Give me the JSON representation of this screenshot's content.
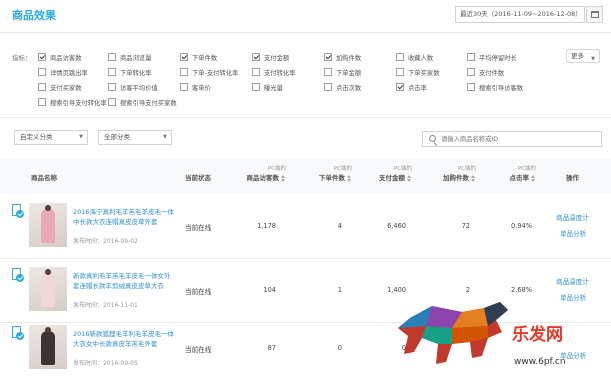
{
  "header": {
    "title": "商品效果",
    "date_range": "最近30天（2016-11-09~2016-12-08）"
  },
  "metrics": {
    "label": "指标：",
    "more_label": "更多",
    "options": [
      {
        "label": "商品访客数",
        "checked": true
      },
      {
        "label": "商品浏览量",
        "checked": false
      },
      {
        "label": "下单件数",
        "checked": true
      },
      {
        "label": "支付金额",
        "checked": true
      },
      {
        "label": "加购件数",
        "checked": true
      },
      {
        "label": "收藏人数",
        "checked": false
      },
      {
        "label": "平均停留时长",
        "checked": false
      },
      {
        "label": "详情页跳出率",
        "checked": false
      },
      {
        "label": "下单转化率",
        "checked": false
      },
      {
        "label": "下单-支付转化率",
        "checked": false
      },
      {
        "label": "支付转化率",
        "checked": false
      },
      {
        "label": "下单金额",
        "checked": false
      },
      {
        "label": "下单买家数",
        "checked": false
      },
      {
        "label": "支付件数",
        "checked": false
      },
      {
        "label": "支付买家数",
        "checked": false
      },
      {
        "label": "访客平均价值",
        "checked": false
      },
      {
        "label": "客单价",
        "checked": false
      },
      {
        "label": "曝光量",
        "checked": false
      },
      {
        "label": "点击次数",
        "checked": false
      },
      {
        "label": "点击率",
        "checked": true
      },
      {
        "label": "搜索引导访客数",
        "checked": false
      },
      {
        "label": "搜索引导支付转化率",
        "checked": false
      },
      {
        "label": "搜索引导支付买家数",
        "checked": false
      }
    ]
  },
  "filters": {
    "custom_category": "自定义分类",
    "all_category": "全部分类",
    "search_placeholder": "请输入商品名称或ID"
  },
  "table": {
    "columns": {
      "product_name": "商品名称",
      "status": "当前状态",
      "visitors_pre": "PC端的",
      "visitors": "商品访客数",
      "order_pre": "PC端的",
      "order": "下单件数",
      "pay_pre": "PC端的",
      "pay": "支付金额",
      "cart_pre": "PC端的",
      "cart": "加购件数",
      "ctr_pre": "PC端的",
      "ctr": "点击率",
      "actions": "操作"
    },
    "rows": [
      {
        "title": "2016海宁真利毛羊羔毛羊皮毛一体中长款大衣连帽真皮皮草外套",
        "publish_time": "发布时间：2016-09-02",
        "status": "当前在线",
        "visitors": "1,178",
        "orders": "4",
        "pay": "6,460",
        "cart": "72",
        "ctr": "0.94%",
        "action1": "商品温度计",
        "action2": "单品分析",
        "thumb_color": "#e9a9b6"
      },
      {
        "title": "新款真利毛羊羔毛羊皮毛一体女外套连帽长款羊剪绒真皮皮草大衣",
        "publish_time": "发布时间：2016-11-01",
        "status": "当前在线",
        "visitors": "104",
        "orders": "1",
        "pay": "1,400",
        "cart": "2",
        "ctr": "2.68%",
        "action1": "商品温度计",
        "action2": "单品分析",
        "thumb_color": "#f0d8d8"
      },
      {
        "title": "2016新款狐狸毛羊利毛羊皮毛一体大衣女中长款真皮羊羔毛外套",
        "publish_time": "发布时间：2016-09-05",
        "status": "当前在线",
        "visitors": "87",
        "orders": "0",
        "pay": "0",
        "cart": "",
        "ctr": "",
        "action1": "",
        "action2": "单品分析",
        "thumb_color": "#3a3434"
      }
    ]
  },
  "watermark": {
    "brand": "乐发网",
    "url": "www.6pf.cn"
  }
}
